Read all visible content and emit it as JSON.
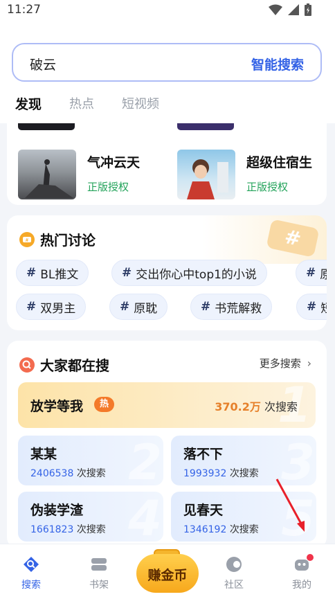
{
  "status": {
    "time": "11:27"
  },
  "search": {
    "query": "破云",
    "smart_label": "智能搜索"
  },
  "tabs": [
    {
      "label": "发现",
      "active": true
    },
    {
      "label": "热点",
      "active": false
    },
    {
      "label": "短视频",
      "active": false
    }
  ],
  "books": [
    {
      "title": "气冲云天",
      "tag": "正版授权"
    },
    {
      "title": "超级住宿生",
      "tag": "正版授权"
    }
  ],
  "topics": {
    "title": "热门讨论",
    "chips": [
      "BL推文",
      "交出你心中top1的小说",
      "原",
      "双男主",
      "原耽",
      "书荒解救",
      "短"
    ]
  },
  "hot_search": {
    "title": "大家都在搜",
    "more_label": "更多搜索",
    "top": {
      "name": "放学等我",
      "hot_label": "热",
      "count": "370.2万",
      "count_unit": "次搜索",
      "rank": "1"
    },
    "items": [
      {
        "name": "某某",
        "count": "2406538",
        "unit": "次搜索",
        "rank": "2"
      },
      {
        "name": "落不下",
        "count": "1993932",
        "unit": "次搜索",
        "rank": "3"
      },
      {
        "name": "伪装学渣",
        "count": "1661823",
        "unit": "次搜索",
        "rank": "4"
      },
      {
        "name": "见春天",
        "count": "1346192",
        "unit": "次搜索",
        "rank": "5"
      }
    ]
  },
  "tabbar": {
    "search": "搜索",
    "shelf": "书架",
    "earn": "赚金币",
    "community": "社区",
    "mine": "我的"
  },
  "colors": {
    "accent": "#3463e6",
    "green": "#23a35a",
    "hot": "#f47a2a"
  }
}
